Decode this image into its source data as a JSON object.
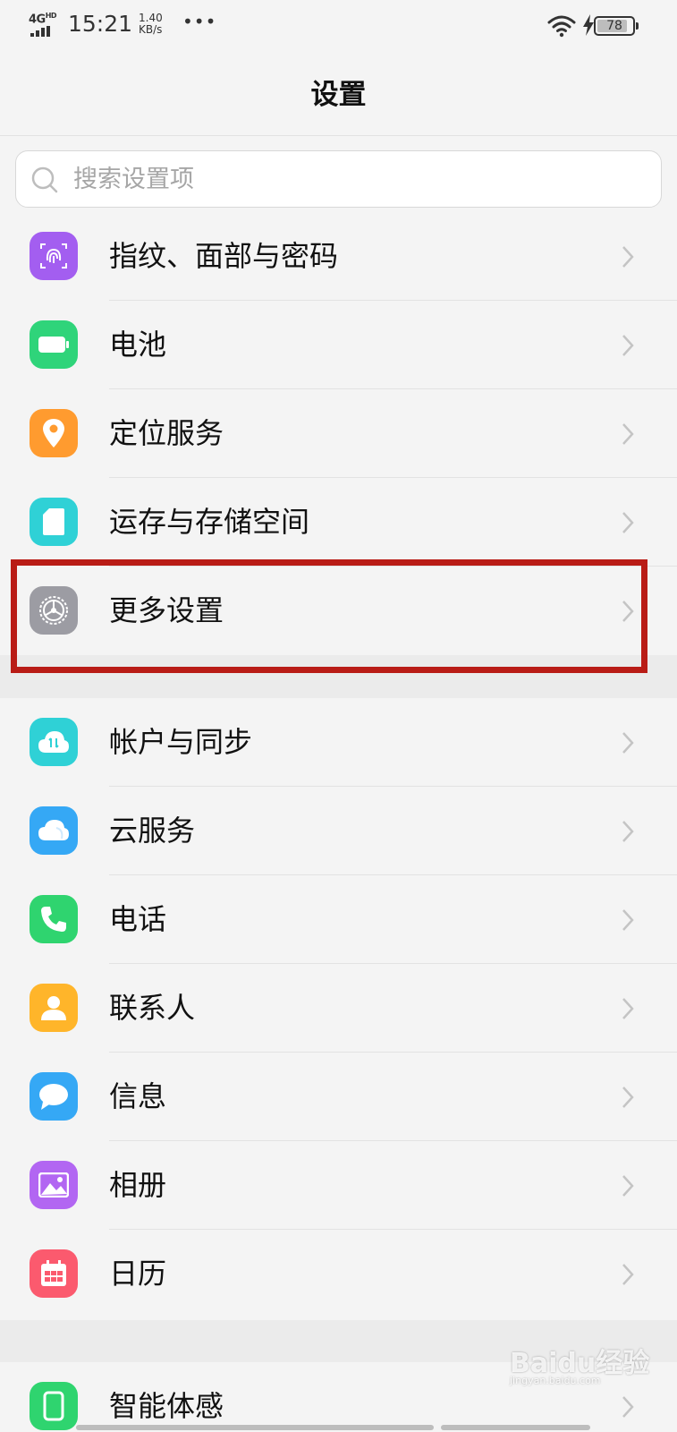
{
  "status_bar": {
    "network": "4G",
    "network_sup": "HD",
    "time": "15:21",
    "speed_value": "1.40",
    "speed_unit": "KB/s",
    "more": "•••",
    "battery_level": "78",
    "icons": [
      "signal-icon",
      "wifi-icon",
      "charging-bolt-icon",
      "battery-icon"
    ]
  },
  "header": {
    "title": "设置"
  },
  "search": {
    "placeholder": "搜索设置项",
    "value": ""
  },
  "groups": [
    {
      "items": [
        {
          "label": "指纹、面部与密码",
          "icon": "fingerprint-icon",
          "color": "#a35ef0"
        },
        {
          "label": "电池",
          "icon": "battery-icon",
          "color": "#2fd47a"
        },
        {
          "label": "定位服务",
          "icon": "location-pin-icon",
          "color": "#ff9b2f"
        },
        {
          "label": "运存与存储空间",
          "icon": "sd-card-icon",
          "color": "#2fd1d6"
        },
        {
          "label": "更多设置",
          "icon": "gear-icon",
          "color": "#9c9ca3"
        }
      ]
    },
    {
      "items": [
        {
          "label": "帐户与同步",
          "icon": "cloud-sync-icon",
          "color": "#2fd1d6"
        },
        {
          "label": "云服务",
          "icon": "cloud-icon",
          "color": "#35a8f5"
        },
        {
          "label": "电话",
          "icon": "phone-icon",
          "color": "#2fd46f"
        },
        {
          "label": "联系人",
          "icon": "contact-icon",
          "color": "#ffb52a"
        },
        {
          "label": "信息",
          "icon": "message-icon",
          "color": "#35a8f5"
        },
        {
          "label": "相册",
          "icon": "gallery-icon",
          "color": "#b266f2"
        },
        {
          "label": "日历",
          "icon": "calendar-icon",
          "color": "#fb5a6e"
        }
      ]
    },
    {
      "items": [
        {
          "label": "智能体感",
          "icon": "smart-motion-icon",
          "color": "#2fd46f"
        }
      ]
    }
  ],
  "colors": {
    "highlight": "#b91c16",
    "background": "#f4f4f4"
  },
  "watermark": {
    "logo": "Baidu经验",
    "site": "jingyan.baidu.com"
  }
}
